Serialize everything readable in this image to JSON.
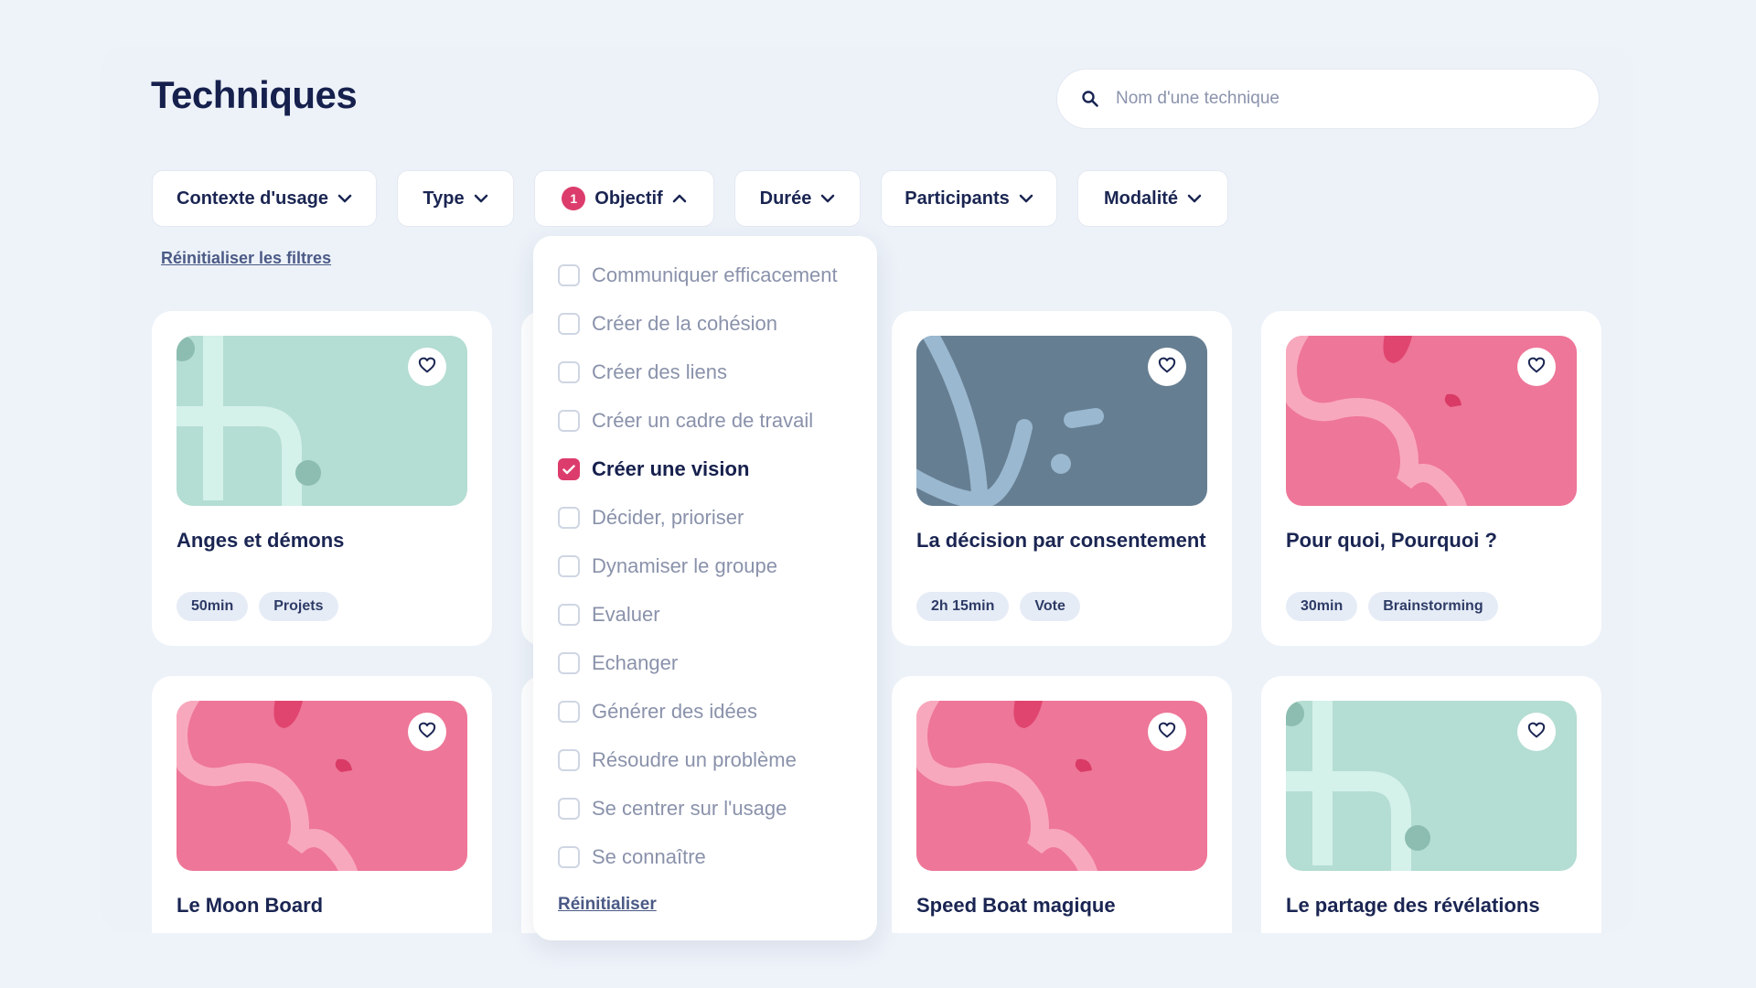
{
  "header": {
    "title": "Techniques",
    "search_placeholder": "Nom d'une technique"
  },
  "filters": {
    "context": "Contexte d'usage",
    "type": "Type",
    "objective": "Objectif",
    "objective_count": "1",
    "duration": "Durée",
    "participants": "Participants",
    "modality": "Modalité",
    "reset_label": "Réinitialiser les filtres"
  },
  "objective_dropdown": {
    "options": [
      {
        "label": "Communiquer efficacement",
        "checked": false
      },
      {
        "label": "Créer de la cohésion",
        "checked": false
      },
      {
        "label": "Créer des liens",
        "checked": false
      },
      {
        "label": "Créer un cadre de travail",
        "checked": false
      },
      {
        "label": "Créer une vision",
        "checked": true
      },
      {
        "label": "Décider, prioriser",
        "checked": false
      },
      {
        "label": "Dynamiser le groupe",
        "checked": false
      },
      {
        "label": "Evaluer",
        "checked": false
      },
      {
        "label": "Echanger",
        "checked": false
      },
      {
        "label": "Générer des idées",
        "checked": false
      },
      {
        "label": "Résoudre un problème",
        "checked": false
      },
      {
        "label": "Se centrer sur l'usage",
        "checked": false
      },
      {
        "label": "Se connaître",
        "checked": false
      }
    ],
    "reset_label": "Réinitialiser"
  },
  "cards": [
    {
      "title": "Anges et démons",
      "tags": [
        "50min",
        "Projets"
      ],
      "theme": "mint"
    },
    {
      "title": "La décision par consentement",
      "tags": [
        "2h 15min",
        "Vote"
      ],
      "theme": "slate"
    },
    {
      "title": "Pour quoi, Pourquoi ?",
      "tags": [
        "30min",
        "Brainstorming"
      ],
      "theme": "pink"
    },
    {
      "title": "Le Moon Board",
      "tags": [],
      "theme": "pink"
    },
    {
      "title": "Speed Boat magique",
      "tags": [],
      "theme": "pink"
    },
    {
      "title": "Le partage des révélations",
      "tags": [],
      "theme": "mint"
    }
  ],
  "colors": {
    "accent": "#dc3c6c",
    "mint": "#b4ddd3",
    "slate": "#667e92",
    "pink": "#ee7698",
    "text": "#1a2552"
  }
}
